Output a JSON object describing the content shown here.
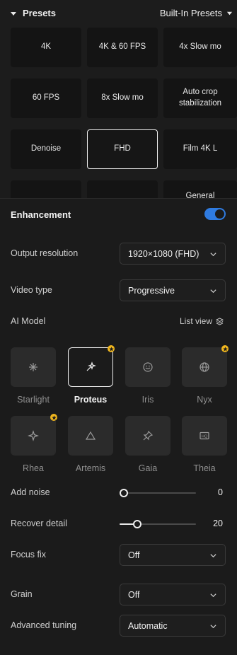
{
  "presets": {
    "title": "Presets",
    "source": "Built-In Presets",
    "items": [
      "4K",
      "4K & 60 FPS",
      "4x Slow mo",
      "60 FPS",
      "8x Slow mo",
      "Auto crop stabilization",
      "Denoise",
      "FHD",
      "Film 4K L",
      "",
      "",
      "General"
    ],
    "selected": "FHD"
  },
  "enhancement": {
    "title": "Enhancement",
    "enabled": true,
    "output_resolution": {
      "label": "Output resolution",
      "value": "1920×1080 (FHD)"
    },
    "video_type": {
      "label": "Video type",
      "value": "Progressive"
    },
    "ai_model": {
      "label": "AI Model",
      "list_view": "List view",
      "models": [
        {
          "name": "Starlight",
          "icon": "sparkle-icon",
          "badge": false
        },
        {
          "name": "Proteus",
          "icon": "magic-wand-icon",
          "badge": true,
          "selected": true
        },
        {
          "name": "Iris",
          "icon": "smiley-face-icon",
          "badge": false
        },
        {
          "name": "Nyx",
          "icon": "globe-icon",
          "badge": true
        },
        {
          "name": "Rhea",
          "icon": "four-point-star-icon",
          "badge": true
        },
        {
          "name": "Artemis",
          "icon": "triangle-icon",
          "badge": false
        },
        {
          "name": "Gaia",
          "icon": "pushpin-icon",
          "badge": false
        },
        {
          "name": "Theia",
          "icon": "hq-icon",
          "badge": false
        }
      ]
    },
    "add_noise": {
      "label": "Add noise",
      "value": "0",
      "level": 0
    },
    "recover_detail": {
      "label": "Recover detail",
      "value": "20",
      "level": 0.2
    },
    "focus_fix": {
      "label": "Focus fix",
      "value": "Off"
    },
    "grain": {
      "label": "Grain",
      "value": "Off"
    },
    "advanced_tuning": {
      "label": "Advanced tuning",
      "value": "Automatic"
    }
  },
  "colors": {
    "accent": "#2f7be0",
    "badge": "#f0b61e",
    "background": "#1b1b1b",
    "tile": "#2b2b2b"
  }
}
